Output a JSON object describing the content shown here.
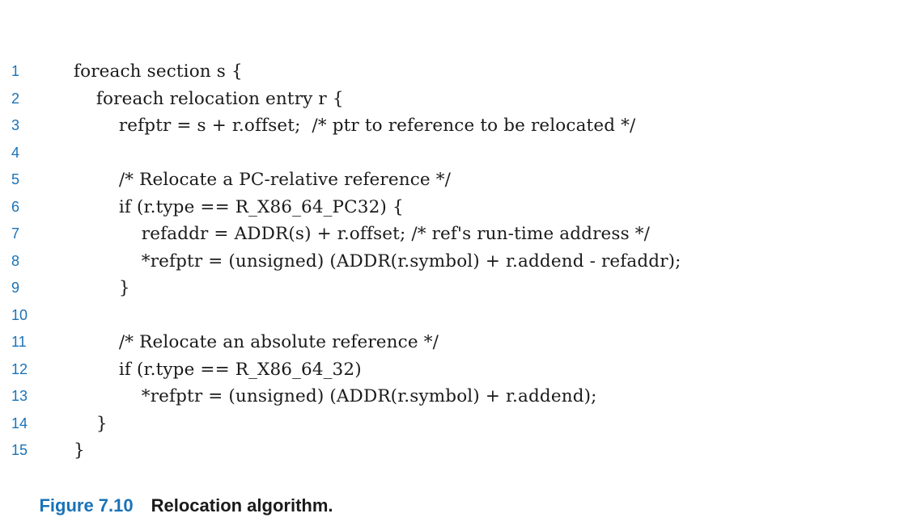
{
  "code_lines": [
    {
      "num": "1",
      "text": "foreach section s {"
    },
    {
      "num": "2",
      "text": "    foreach relocation entry r {"
    },
    {
      "num": "3",
      "text": "        refptr = s + r.offset;  /* ptr to reference to be relocated */"
    },
    {
      "num": "4",
      "text": ""
    },
    {
      "num": "5",
      "text": "        /* Relocate a PC-relative reference */"
    },
    {
      "num": "6",
      "text": "        if (r.type == R_X86_64_PC32) {"
    },
    {
      "num": "7",
      "text": "            refaddr = ADDR(s) + r.offset; /* ref's run-time address */"
    },
    {
      "num": "8",
      "text": "            *refptr = (unsigned) (ADDR(r.symbol) + r.addend - refaddr);"
    },
    {
      "num": "9",
      "text": "        }"
    },
    {
      "num": "10",
      "text": ""
    },
    {
      "num": "11",
      "text": "        /* Relocate an absolute reference */"
    },
    {
      "num": "12",
      "text": "        if (r.type == R_X86_64_32)"
    },
    {
      "num": "13",
      "text": "            *refptr = (unsigned) (ADDR(r.symbol) + r.addend);"
    },
    {
      "num": "14",
      "text": "    }"
    },
    {
      "num": "15",
      "text": "}"
    }
  ],
  "caption": {
    "label": "Figure 7.10",
    "title": "Relocation algorithm."
  },
  "colors": {
    "accent": "#1a73b8",
    "text": "#1a1a1a"
  }
}
